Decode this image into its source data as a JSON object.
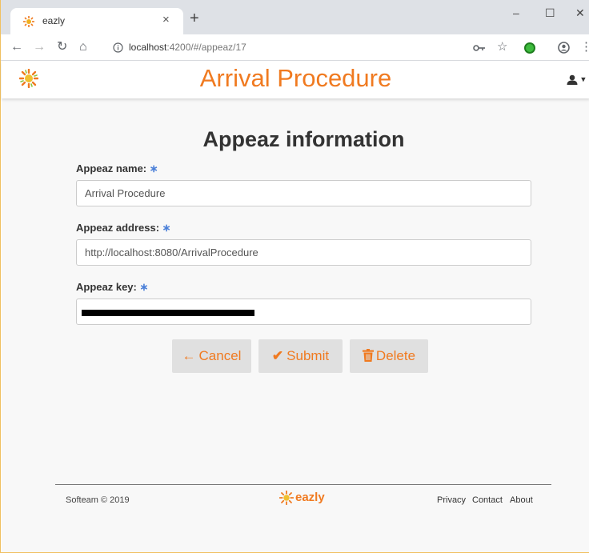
{
  "browser": {
    "tab_title": "eazly",
    "tab_close": "×",
    "new_tab": "+",
    "url_host": "localhost",
    "url_path": ":4200/#/appeaz/17",
    "window_minimize": "–",
    "window_maximize": "☐",
    "window_close": "✕",
    "icons": [
      "back-icon",
      "forward-icon",
      "reload-icon",
      "home-icon",
      "info-icon",
      "key-icon",
      "star-icon",
      "extension-icon",
      "account-icon",
      "menu-icon"
    ]
  },
  "navbar": {
    "title": "Arrival Procedure",
    "user_menu": "▾"
  },
  "form": {
    "heading": "Appeaz information",
    "required_marker": "∗",
    "fields": [
      {
        "label": "Appeaz name:",
        "value": "Arrival Procedure"
      },
      {
        "label": "Appeaz address:",
        "value": "http://localhost:8080/ArrivalProcedure"
      },
      {
        "label": "Appeaz key:",
        "value": ""
      }
    ],
    "buttons": {
      "cancel": {
        "icon": "←",
        "label": "Cancel"
      },
      "submit": {
        "icon": "✔",
        "label": "Submit"
      },
      "delete": {
        "icon": "🗑",
        "label": "Delete"
      }
    }
  },
  "footer": {
    "copyright": "Softeam © 2019",
    "brand": "eazly",
    "links": [
      "Privacy",
      "Contact",
      "About"
    ]
  },
  "colors": {
    "brand_orange": "#f07a20",
    "required_blue": "#4a7fd8",
    "button_gray": "#e0e0e0"
  }
}
